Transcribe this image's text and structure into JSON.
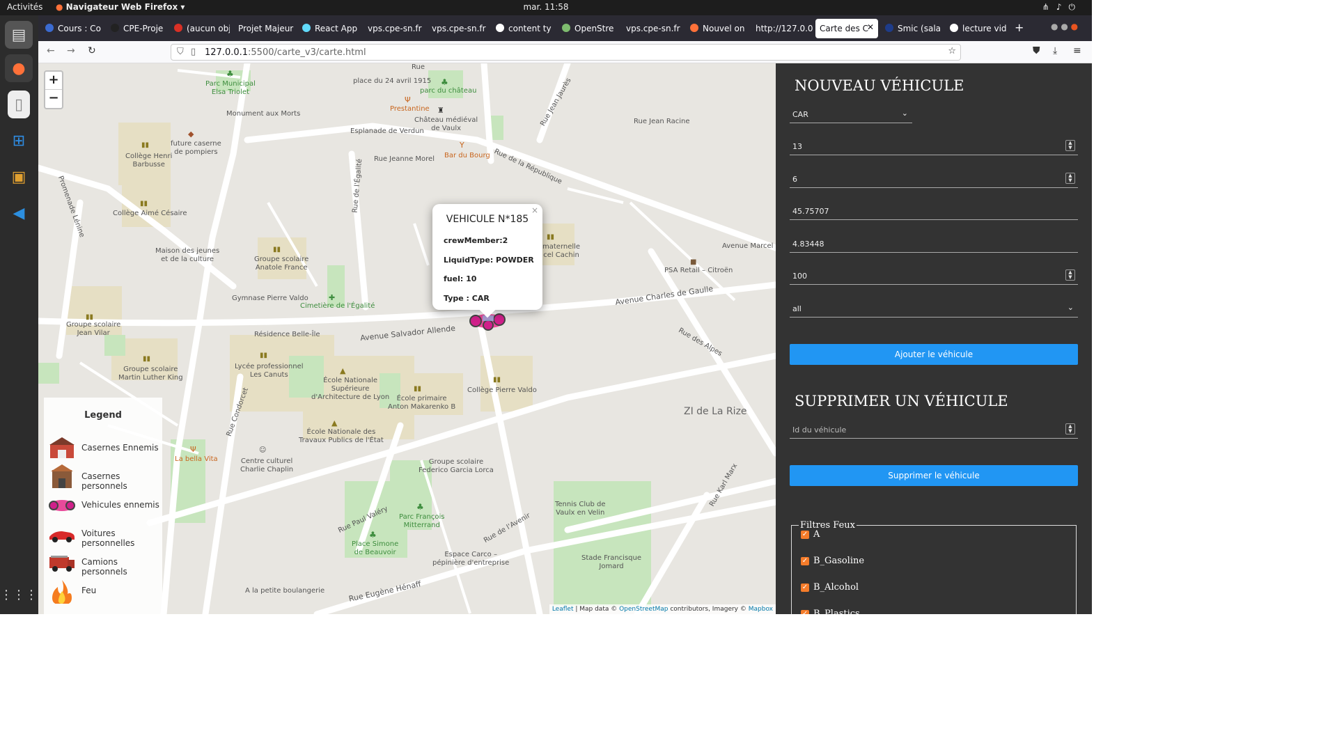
{
  "system": {
    "activities": "Activités",
    "app_name": "Navigateur Web Firefox",
    "clock": "mar. 11:58"
  },
  "tabs": [
    {
      "label": "Cours : Co",
      "color": "#3b6bd1"
    },
    {
      "label": "CPE-Proje",
      "color": "#222222"
    },
    {
      "label": "(aucun obj",
      "color": "#d93025"
    },
    {
      "label": "Projet Majeur",
      "color": "#2b2a33"
    },
    {
      "label": "React App",
      "color": "#61dafb"
    },
    {
      "label": "vps.cpe-sn.fr",
      "color": "#2b2a33"
    },
    {
      "label": "vps.cpe-sn.fr",
      "color": "#2b2a33"
    },
    {
      "label": "content ty",
      "color": "#ffffff"
    },
    {
      "label": "OpenStre",
      "color": "#7ebc6f"
    },
    {
      "label": "vps.cpe-sn.fr",
      "color": "#2b2a33"
    },
    {
      "label": "Nouvel on",
      "color": "#ff7139"
    },
    {
      "label": "http://127.0.0",
      "color": "#2b2a33"
    },
    {
      "label": "Carte des C",
      "color": "#2b2a33"
    },
    {
      "label": "Smic (sala",
      "color": "#1e3c8a"
    },
    {
      "label": "lecture vid",
      "color": "#ffffff"
    }
  ],
  "url": {
    "host": "127.0.0.1",
    "path": ":5500/carte_v3/carte.html"
  },
  "map": {
    "zoom_in": "+",
    "zoom_out": "−",
    "labels": [
      "Parc Municipal\nElsa Triolet",
      "place du 24 avril 1915",
      "parc du château",
      "Monument aux Morts",
      "Prestantine",
      "Château médiéval\nde Vaulx",
      "Esplanade de Verdun",
      "Rue Jean Jaurès",
      "Rue Jean Racine",
      "Collège Henri\nBarbusse",
      "future caserne\nde pompiers",
      "Bar du Bourg",
      "Rue Jeanne Morel",
      "Rue de la République",
      "Collège Aimé Césaire",
      "Rue de l'Égalité",
      "Maison des jeunes\net de la culture",
      "Groupe scolaire\nAnatole France",
      "maternelle\ncel Cachin",
      "Avenue Marcel C",
      "PSA Retail – Citroën",
      "Gymnase Pierre Valdo",
      "Cimetière de l'Égalité",
      "Avenue Charles de Gaulle",
      "Groupe scolaire\nJean Vilar",
      "Résidence Belle-Île",
      "Avenue Salvador Allende",
      "Rue des Alpes",
      "Groupe scolaire\nMartin Luther King",
      "Lycée professionnel\nLes Canuts",
      "École Nationale\nSupérieure\nd'Architecture de Lyon",
      "École primaire\nAnton Makarenko B",
      "Collège Pierre Valdo",
      "ZI de La Rize",
      "Rue Condorcet",
      "École Nationale des\nTravaux Publics de l'État",
      "La bella Vita",
      "Centre culturel\nCharlie Chaplin",
      "Groupe scolaire\nFederico Garcia Lorca",
      "Rue Karl Marx",
      "Tennis Club de\nVaulx en Velin",
      "Rue Paul Valéry",
      "Parc François\nMitterrand",
      "Rue de l'Avenir",
      "Place Simone\nde Beauvoir",
      "Espace Carco –\npépinière d'entreprise",
      "Stade Francisque\nJomard",
      "Rue Eugène Hénaff",
      "A la petite boulangerie",
      "Promenade Lénine",
      "Rue"
    ]
  },
  "popup": {
    "title": "VEHICULE N*185",
    "close": "×",
    "crew": "crewMember:2",
    "liquid": "LiquidType: POWDER",
    "fuel": "fuel: 10",
    "type": "Type : CAR"
  },
  "legend": {
    "title": "Legend",
    "items": [
      {
        "label": "Casernes Ennemis",
        "icon": "enemy-barracks-icon"
      },
      {
        "label": "Casernes personnels",
        "icon": "own-barracks-icon"
      },
      {
        "label": "Vehicules ennemis",
        "icon": "enemy-vehicle-icon"
      },
      {
        "label": "Voitures personnelles",
        "icon": "own-car-icon"
      },
      {
        "label": "Camions personnels",
        "icon": "own-truck-icon"
      },
      {
        "label": "Feu",
        "icon": "fire-icon"
      }
    ]
  },
  "attribution": {
    "leaflet": "Leaflet",
    "text": " | Map data © ",
    "osm": "OpenStreetMap",
    "text2": " contributors, Imagery © ",
    "mapbox": "Mapbox"
  },
  "panel": {
    "new_title": "NOUVEAU VÉHICULE",
    "type_select": "CAR",
    "field1": "13",
    "field2": "6",
    "lat": "45.75707",
    "lon": "4.83448",
    "field5": "100",
    "liquid_select": "all",
    "add_button": "Ajouter le véhicule",
    "delete_title": "SUPPRIMER UN VÉHICULE",
    "delete_placeholder": "Id du véhicule",
    "delete_button": "Supprimer le véhicule",
    "filters_title": "Filtres Feux",
    "filters": [
      "A",
      "B_Gasoline",
      "B_Alcohol",
      "B_Plastics"
    ]
  },
  "colors": {
    "accent": "#2196f3",
    "panel_bg": "#333333",
    "checkbox": "#f57c2a"
  }
}
